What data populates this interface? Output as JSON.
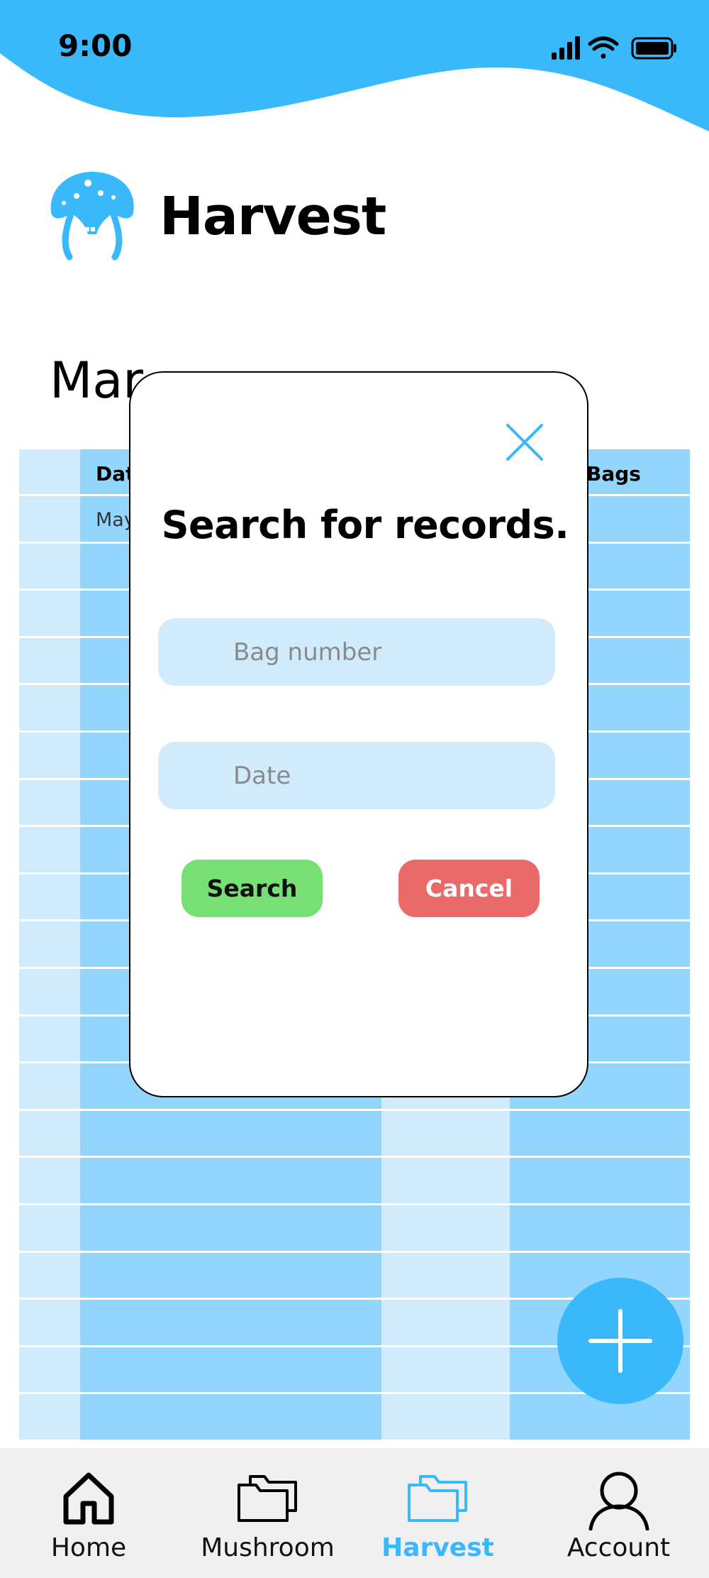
{
  "status_bar": {
    "time": "9:00",
    "icons": [
      "signal-icon",
      "wifi-icon",
      "battery-icon"
    ]
  },
  "header": {
    "title": "Harvest",
    "logo_icon": "mushroom-logo-icon"
  },
  "section": {
    "heading_visible": "Mar"
  },
  "table": {
    "headers": {
      "date": "Dat",
      "bags": "Bags"
    },
    "first_cell": "May"
  },
  "modal": {
    "title": "Search for records.",
    "bag_placeholder": "Bag number",
    "date_placeholder": "Date",
    "search_label": "Search",
    "cancel_label": "Cancel"
  },
  "fab": {
    "icon": "plus-icon"
  },
  "nav": {
    "items": [
      {
        "label": "Home",
        "icon": "home-icon"
      },
      {
        "label": "Mushroom",
        "icon": "folder-icon"
      },
      {
        "label": "Harvest",
        "icon": "folder-icon"
      },
      {
        "label": "Account",
        "icon": "user-icon"
      }
    ],
    "active": "Harvest"
  },
  "colors": {
    "accent": "#3ab8fc",
    "table_dark": "#92d6fd",
    "table_light": "#d0ebfc",
    "search_green": "#76e075",
    "cancel_red": "#e96a69",
    "nav_bg": "#f0f0f0"
  }
}
